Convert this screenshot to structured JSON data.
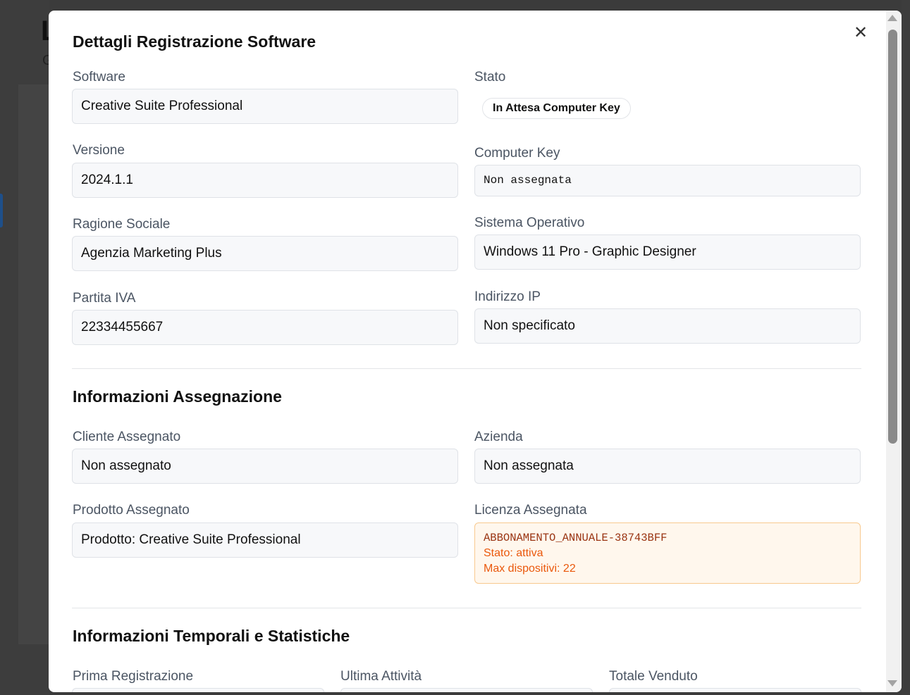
{
  "background": {
    "letter": "L",
    "sub": "G"
  },
  "modal": {
    "title": "Dettagli Registrazione Software",
    "close_icon": "close-icon"
  },
  "details": {
    "software_label": "Software",
    "software_value": "Creative Suite Professional",
    "stato_label": "Stato",
    "stato_value": "In Attesa Computer Key",
    "versione_label": "Versione",
    "versione_value": "2024.1.1",
    "computer_key_label": "Computer Key",
    "computer_key_value": "Non assegnata",
    "ragione_sociale_label": "Ragione Sociale",
    "ragione_sociale_value": "Agenzia Marketing Plus",
    "sistema_operativo_label": "Sistema Operativo",
    "sistema_operativo_value": "Windows 11 Pro - Graphic Designer",
    "partita_iva_label": "Partita IVA",
    "partita_iva_value": "22334455667",
    "indirizzo_ip_label": "Indirizzo IP",
    "indirizzo_ip_value": "Non specificato"
  },
  "assegnazione": {
    "title": "Informazioni Assegnazione",
    "cliente_label": "Cliente Assegnato",
    "cliente_value": "Non assegnato",
    "azienda_label": "Azienda",
    "azienda_value": "Non assegnata",
    "prodotto_label": "Prodotto Assegnato",
    "prodotto_value": "Prodotto: Creative Suite Professional",
    "licenza_label": "Licenza Assegnata",
    "licenza_code": "ABBONAMENTO_ANNUALE-38743BFF",
    "licenza_stato": "Stato: attiva",
    "licenza_max": "Max dispositivi: 22"
  },
  "temporali": {
    "title": "Informazioni Temporali e Statistiche",
    "prima_label": "Prima Registrazione",
    "ultima_label": "Ultima Attività",
    "totale_label": "Totale Venduto"
  },
  "colors": {
    "license_bg": "#fff7ed",
    "license_border": "#f8c98f",
    "license_text": "#ea580c"
  }
}
